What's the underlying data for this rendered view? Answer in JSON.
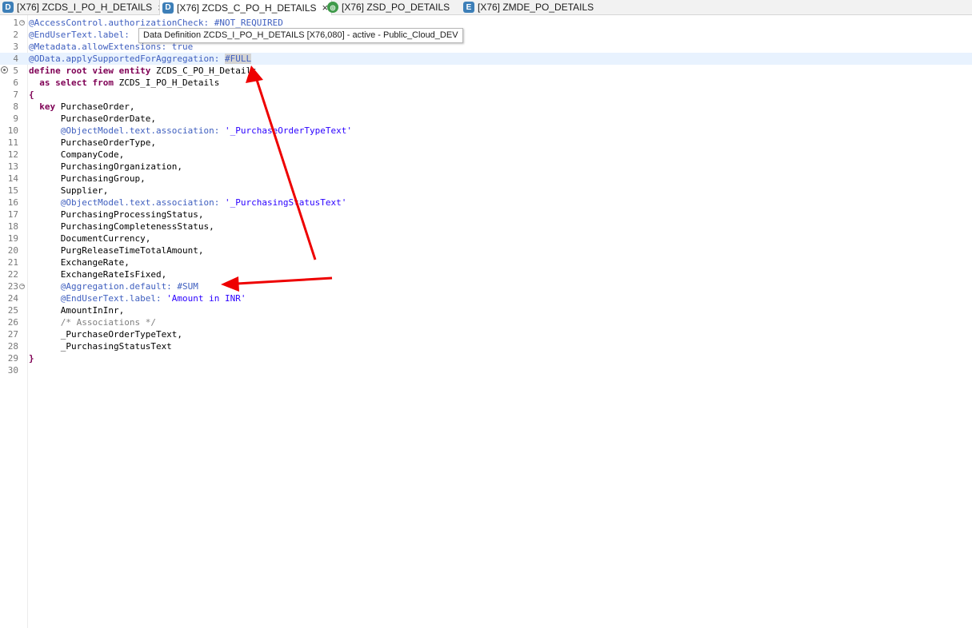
{
  "tabs": [
    {
      "icon": "D",
      "label": "[X76] ZCDS_I_PO_H_DETAILS",
      "close": "×"
    },
    {
      "icon": "D",
      "label": "[X76] ZCDS_C_PO_H_DETAILS",
      "close": "×"
    },
    {
      "icon": "◎",
      "label": "[X76] ZSD_PO_DETAILS"
    },
    {
      "icon": "E",
      "label": "[X76] ZMDE_PO_DETAILS"
    }
  ],
  "tooltip": "Data Definition ZCDS_I_PO_H_DETAILS [X76,080] - active - Public_Cloud_DEV",
  "line_numbers": [
    "1",
    "2",
    "3",
    "4",
    "5",
    "6",
    "7",
    "8",
    "9",
    "10",
    "11",
    "12",
    "13",
    "14",
    "15",
    "16",
    "17",
    "18",
    "19",
    "20",
    "21",
    "22",
    "23",
    "24",
    "25",
    "26",
    "27",
    "28",
    "29",
    "30"
  ],
  "code": {
    "l1": "@AccessControl.authorizationCheck: #NOT_REQUIRED",
    "l2": "@EndUserText.label: ",
    "l3": "@Metadata.allowExtensions: true",
    "l4a": "@OData.applySupportedForAggregation: ",
    "l4b": "#FULL",
    "l5kw": "define root view entity",
    "l5b": " ZCDS_C_PO_H_Details",
    "l6kw": "  as select from",
    "l6b": " ZCDS_I_PO_H_Details",
    "l7": "{",
    "l8kw": "  key",
    "l8b": " PurchaseOrder,",
    "l9": "      PurchaseOrderDate,",
    "l10a": "      @ObjectModel.text.association: ",
    "l10b": "'_PurchaseOrderTypeText'",
    "l11": "      PurchaseOrderType,",
    "l12": "      CompanyCode,",
    "l13": "      PurchasingOrganization,",
    "l14": "      PurchasingGroup,",
    "l15": "      Supplier,",
    "l16a": "      @ObjectModel.text.association: ",
    "l16b": "'_PurchasingStatusText'",
    "l17": "      PurchasingProcessingStatus,",
    "l18": "      PurchasingCompletenessStatus,",
    "l19": "      DocumentCurrency,",
    "l20": "      PurgReleaseTimeTotalAmount,",
    "l21": "      ExchangeRate,",
    "l22": "      ExchangeRateIsFixed,",
    "l23": "      @Aggregation.default: #SUM",
    "l24a": "      @EndUserText.label: ",
    "l24b": "'Amount in INR'",
    "l25": "      AmountInInr,",
    "l26": "      /* Associations */",
    "l27": "      _PurchaseOrderTypeText,",
    "l28": "      _PurchasingStatusText",
    "l29": "}",
    "l30": ""
  },
  "colors": {
    "keyword": "#7f0055",
    "annotation": "#3f5fbf",
    "string": "#2a00ff",
    "comment": "#808080",
    "arrow": "#ee0000",
    "highlight_line": "#e8f2fe"
  }
}
